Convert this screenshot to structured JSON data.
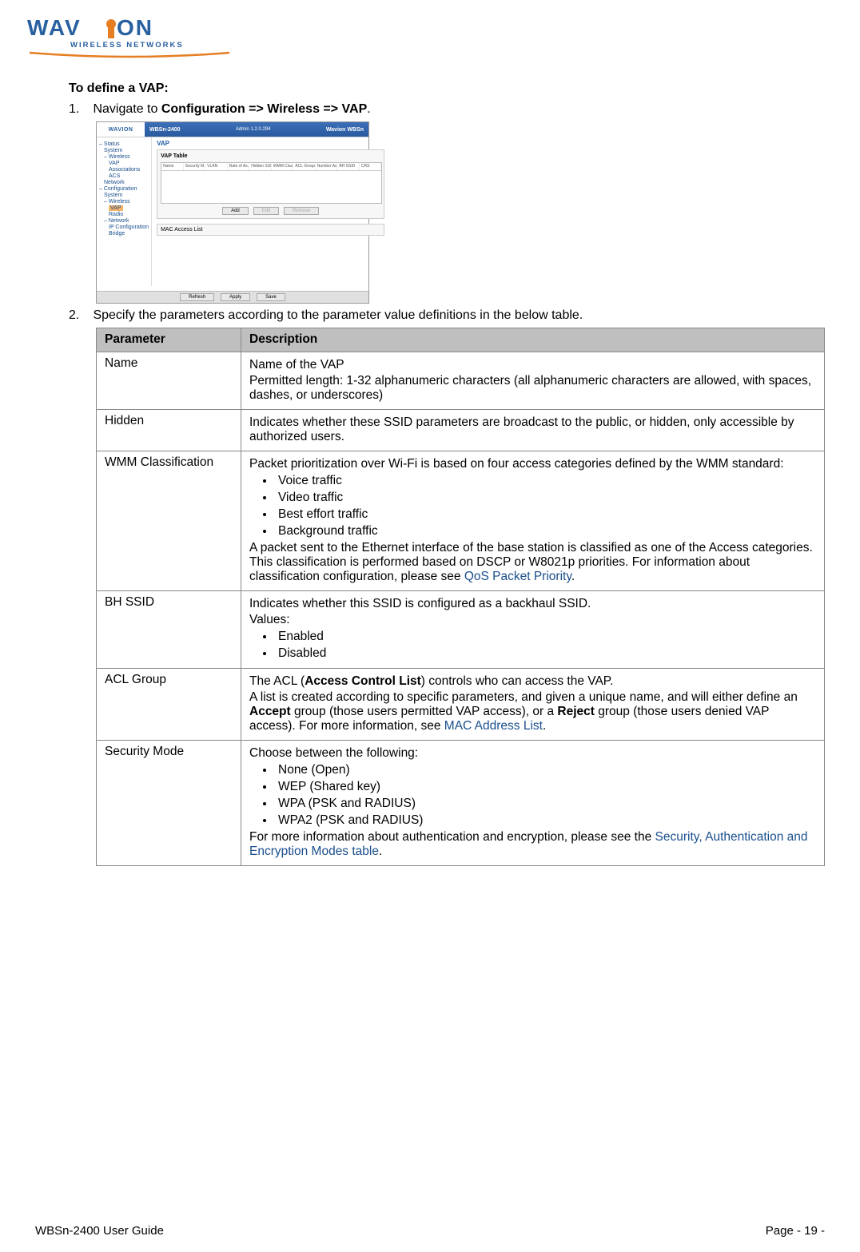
{
  "logo": {
    "brand_top": "WAVION",
    "brand_bottom": "WIRELESS NETWORKS"
  },
  "content": {
    "heading": "To define a VAP:",
    "step1_num": "1.",
    "step1_prefix": "Navigate to ",
    "step1_bold": "Configuration => Wireless => VAP",
    "step1_suffix": ".",
    "step2_num": "2.",
    "step2_text": "Specify the parameters according to the parameter value definitions in the below table."
  },
  "screenshot": {
    "logo_text": "WAVION",
    "title_left": "WBSn-2400",
    "title_mid": "Admin 1.2.0.294",
    "title_right": "Wavion WBSn",
    "sidebar": {
      "i0": "– Status",
      "i1": "System",
      "i2": "– Wireless",
      "i3": "VAP",
      "i4": "Associations",
      "i5": "ACS",
      "i6": "Network",
      "i7": "– Configuration",
      "i8": "System",
      "i9": "– Wireless",
      "i10": "VAP",
      "i11": "Radio",
      "i12": "– Network",
      "i13": "IP Configuration",
      "i14": "Bridge"
    },
    "main_title": "VAP",
    "panel_title": "VAP Table",
    "table_headers": {
      "h0": "Name",
      "h1": "Security M...",
      "h2": "VLAN",
      "h3": "Rate of As...",
      "h4": "Hidden SSID",
      "h5": "WMM Clas...",
      "h6": "ACL Group",
      "h7": "Number As...",
      "h8": "BH SSID",
      "h9": "CRS"
    },
    "buttons": {
      "add": "Add",
      "edit": "Edit",
      "remove": "Remove",
      "refresh": "Refresh",
      "apply": "Apply",
      "save": "Save"
    },
    "mac_panel": "MAC Access List"
  },
  "table": {
    "th_param": "Parameter",
    "th_desc": "Description",
    "r0": {
      "param": "Name",
      "line1": "Name of the VAP",
      "line2": "Permitted length: 1-32 alphanumeric characters (all alphanumeric characters are allowed, with spaces, dashes, or underscores)"
    },
    "r1": {
      "param": "Hidden",
      "line1": "Indicates whether these SSID parameters are broadcast to the public, or hidden, only accessible by authorized users."
    },
    "r2": {
      "param": "WMM Classification",
      "line1": "Packet prioritization over Wi-Fi is based on four access categories defined by the WMM standard:",
      "b1": "Voice traffic",
      "b2": "Video traffic",
      "b3": "Best effort traffic",
      "b4": "Background traffic",
      "line2_a": "A packet sent to the Ethernet interface of the base station is classified as one of the Access categories. This classification is performed based on DSCP or W8021p priorities. For information about classification configuration, please see ",
      "line2_link": "QoS Packet Priority",
      "line2_b": "."
    },
    "r3": {
      "param": "BH SSID",
      "line1": "Indicates whether this SSID is configured as a backhaul SSID.",
      "line2": "Values:",
      "b1": "Enabled",
      "b2": "Disabled"
    },
    "r4": {
      "param": "ACL Group",
      "l1a": "The ACL (",
      "l1b": "Access Control List",
      "l1c": ") controls who can access the VAP.",
      "l2a": "A list is created according to specific parameters, and given a unique name, and will either define an ",
      "l2b": "Accept",
      "l2c": " group (those users permitted VAP access), or a ",
      "l2d": "Reject",
      "l2e": " group (those users denied VAP access). For more information, see ",
      "l2link": "MAC Address List",
      "l2f": "."
    },
    "r5": {
      "param": "Security Mode",
      "line1": "Choose between the following:",
      "b1": "None (Open)",
      "b2": "WEP (Shared key)",
      "b3": "WPA (PSK and RADIUS)",
      "b4": "WPA2 (PSK and RADIUS)",
      "line2a": "For more information about authentication and encryption, please see the ",
      "line2link": "Security, Authentication and Encryption Modes table",
      "line2b": "."
    }
  },
  "footer": {
    "left": "WBSn-2400 User Guide",
    "right": "Page - 19 -"
  }
}
